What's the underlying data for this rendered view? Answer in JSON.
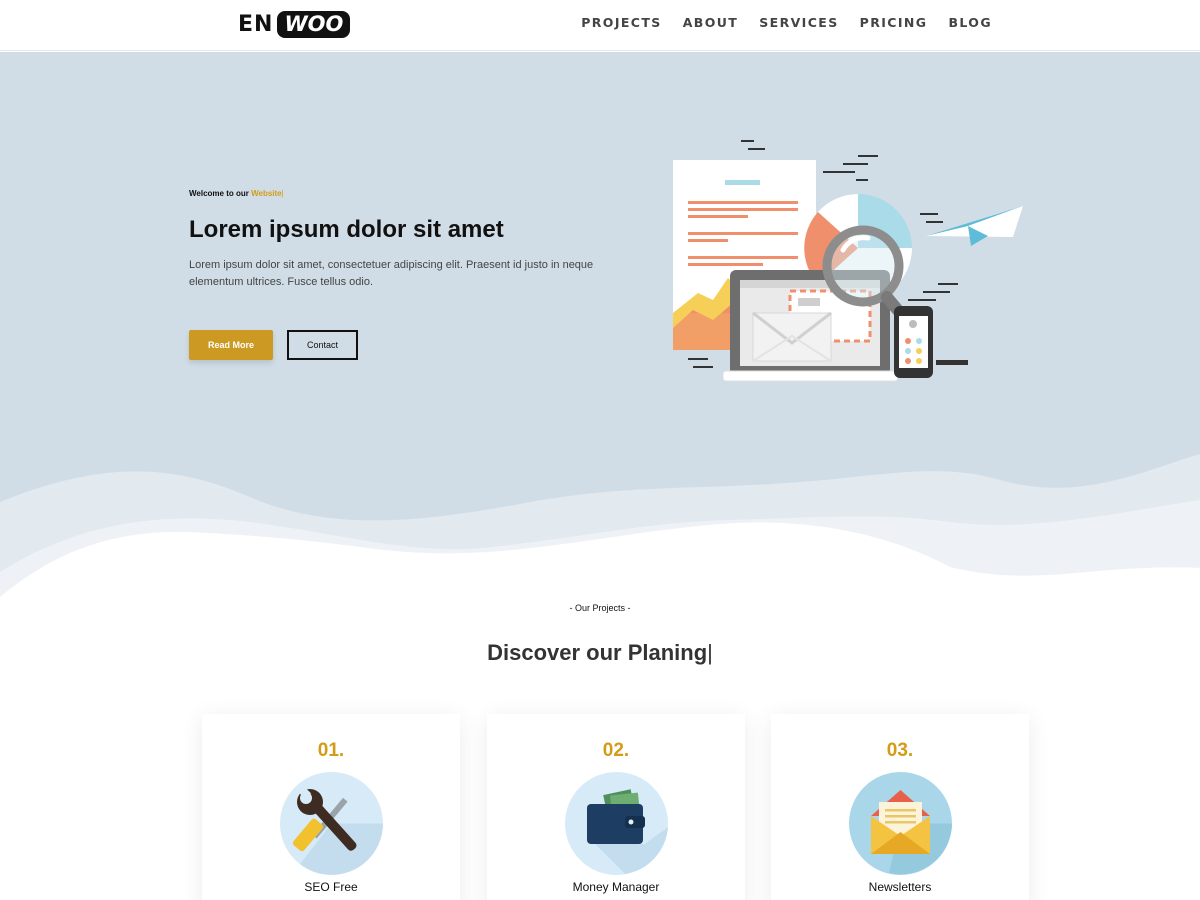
{
  "header": {
    "logo_left": "EN",
    "logo_right": "WOO",
    "nav": [
      "PROJECTS",
      "ABOUT",
      "SERVICES",
      "PRICING",
      "BLOG"
    ]
  },
  "hero": {
    "welcome_prefix": "Welcome to our ",
    "welcome_accent": "Website",
    "welcome_cursor": "|",
    "title": "Lorem ipsum dolor sit amet",
    "description": "Lorem ipsum dolor sit amet, consectetuer adipiscing elit. Praesent id justo in neque elementum ultrices. Fusce tellus odio.",
    "primary_button": "Read More",
    "secondary_button": "Contact",
    "illustration": "marketing-analytics-illustration"
  },
  "projects": {
    "eyebrow": "- Our Projects -",
    "title": "Discover our Planing",
    "title_cursor": "|",
    "cards": [
      {
        "number": "01.",
        "label": "SEO Free",
        "icon": "tools-icon"
      },
      {
        "number": "02.",
        "label": "Money Manager",
        "icon": "wallet-icon"
      },
      {
        "number": "03.",
        "label": "Newsletters",
        "icon": "envelope-icon"
      }
    ]
  },
  "colors": {
    "accent": "#d39c17",
    "hero_background": "#d0dde6",
    "button": "#cc9a22"
  }
}
